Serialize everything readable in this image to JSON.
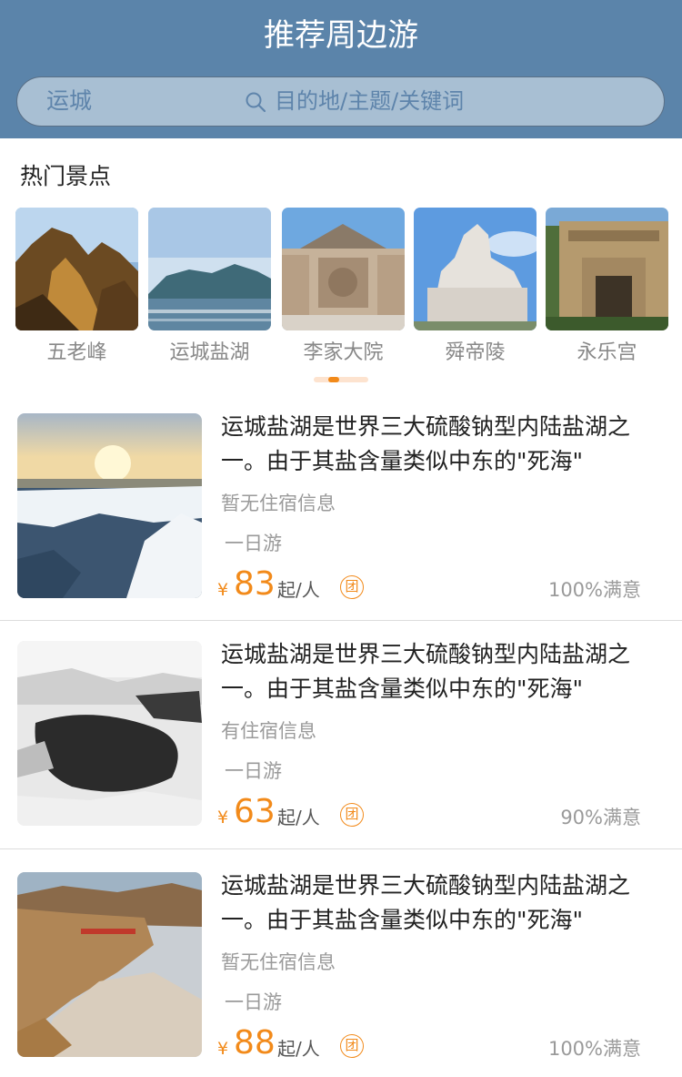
{
  "header": {
    "title": "推荐周边游",
    "city": "运城",
    "search_placeholder": "目的地/主题/关键词"
  },
  "hot_spots": {
    "title": "热门景点",
    "items": [
      {
        "label": "五老峰"
      },
      {
        "label": "运城盐湖"
      },
      {
        "label": "李家大院"
      },
      {
        "label": "舜帝陵"
      },
      {
        "label": "永乐宫"
      }
    ]
  },
  "trips": [
    {
      "title": "运城盐湖是世界三大硫酸钠型内陆盐湖之一。由于其盐含量类似中东的\"死海\"",
      "lodging": "暂无住宿信息",
      "type": "一日游",
      "yen": "¥",
      "price": "83",
      "unit": "起/人",
      "badge": "团",
      "satisfaction": "100%满意"
    },
    {
      "title": "运城盐湖是世界三大硫酸钠型内陆盐湖之一。由于其盐含量类似中东的\"死海\"",
      "lodging": "有住宿信息",
      "type": "一日游",
      "yen": "¥",
      "price": "63",
      "unit": "起/人",
      "badge": "团",
      "satisfaction": "90%满意"
    },
    {
      "title": "运城盐湖是世界三大硫酸钠型内陆盐湖之一。由于其盐含量类似中东的\"死海\"",
      "lodging": "暂无住宿信息",
      "type": "一日游",
      "yen": "¥",
      "price": "88",
      "unit": "起/人",
      "badge": "团",
      "satisfaction": "100%满意"
    }
  ],
  "colors": {
    "header_bg": "#5b84aa",
    "accent": "#f28a1a",
    "search_bg": "#a8bfd3"
  }
}
